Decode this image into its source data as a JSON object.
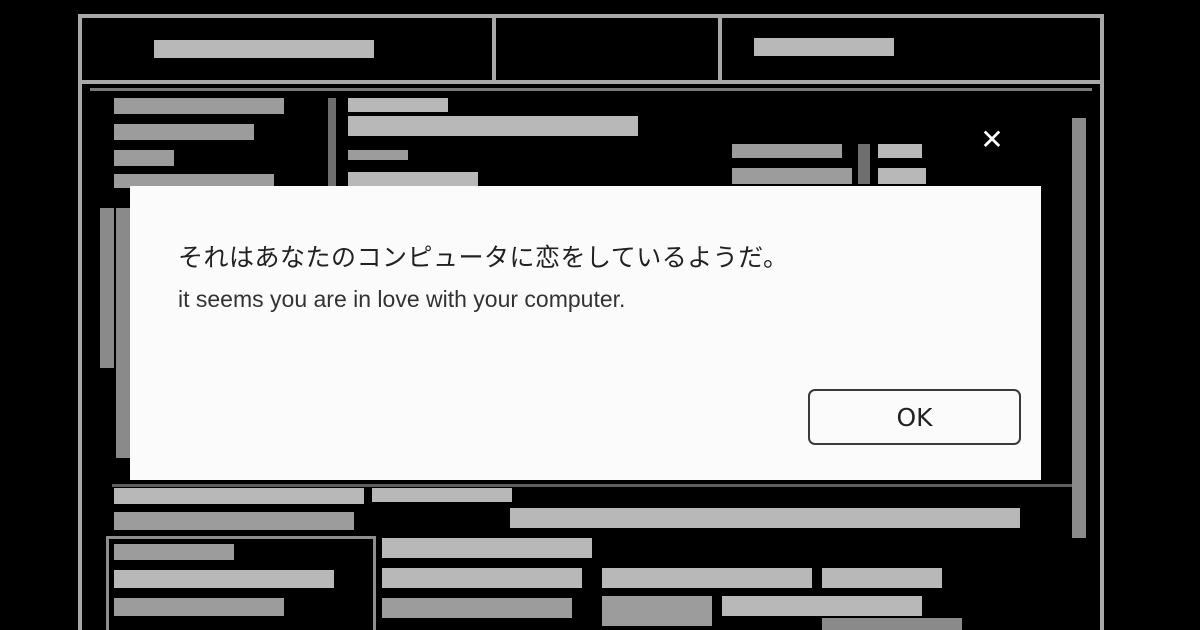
{
  "dialog": {
    "message_jp": "それはあなたのコンピュータに恋をしているようだ。",
    "message_en": "it seems you are in love with your computer.",
    "ok_label": "OK",
    "close_glyph": "✕"
  },
  "colors": {
    "backdrop": "#000000",
    "dialog_bg": "#fbfbfb",
    "text": "#222222",
    "button_border": "#3a3a3a",
    "background_form": "#a8a8a8"
  },
  "icons": {
    "close": "close-icon"
  }
}
